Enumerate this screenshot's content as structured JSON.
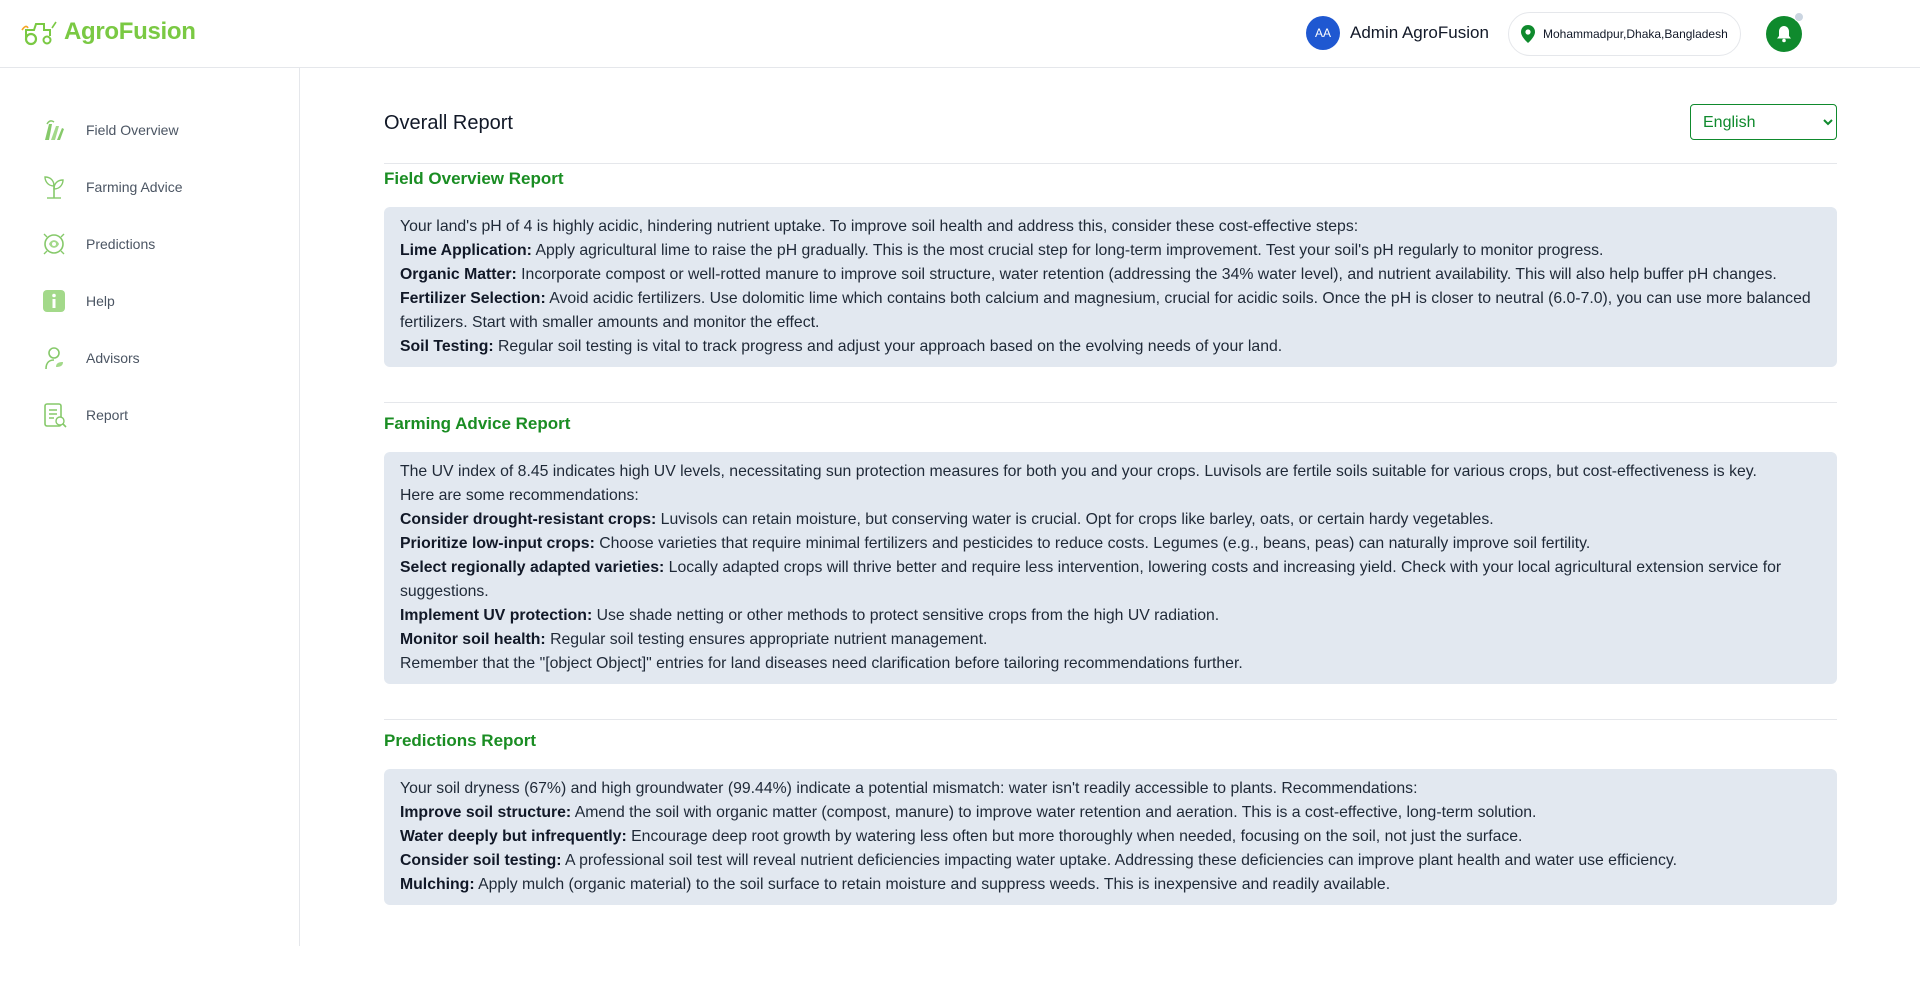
{
  "brand": {
    "name": "AgroFusion"
  },
  "header": {
    "avatar_initials": "AA",
    "user_name": "Admin AgroFusion",
    "location": "Mohammadpur,Dhaka,Bangladesh"
  },
  "colors": {
    "brand_green": "#7ac943",
    "accent_green": "#0f8a2d",
    "avatar_blue": "#1f58d1",
    "report_box": "#e2e8f0"
  },
  "sidebar": {
    "items": [
      {
        "label": "Field Overview",
        "icon": "field-icon"
      },
      {
        "label": "Farming Advice",
        "icon": "plant-icon"
      },
      {
        "label": "Predictions",
        "icon": "prediction-icon"
      },
      {
        "label": "Help",
        "icon": "info-icon"
      },
      {
        "label": "Advisors",
        "icon": "advisor-icon"
      },
      {
        "label": "Report",
        "icon": "report-icon"
      }
    ]
  },
  "main": {
    "title": "Overall Report",
    "language": {
      "selected": "English"
    },
    "sections": [
      {
        "title": "Field Overview Report",
        "lines": [
          {
            "bold": "",
            "text": "Your land's pH of 4 is highly acidic, hindering nutrient uptake. To improve soil health and address this, consider these cost-effective steps:"
          },
          {
            "bold": "Lime Application:",
            "text": " Apply agricultural lime to raise the pH gradually. This is the most crucial step for long-term improvement. Test your soil's pH regularly to monitor progress."
          },
          {
            "bold": "Organic Matter:",
            "text": " Incorporate compost or well-rotted manure to improve soil structure, water retention (addressing the 34% water level), and nutrient availability. This will also help buffer pH changes."
          },
          {
            "bold": "Fertilizer Selection:",
            "text": " Avoid acidic fertilizers. Use dolomitic lime which contains both calcium and magnesium, crucial for acidic soils. Once the pH is closer to neutral (6.0-7.0), you can use more balanced fertilizers. Start with smaller amounts and monitor the effect."
          },
          {
            "bold": "Soil Testing:",
            "text": " Regular soil testing is vital to track progress and adjust your approach based on the evolving needs of your land."
          }
        ]
      },
      {
        "title": "Farming Advice Report",
        "lines": [
          {
            "bold": "",
            "text": "The UV index of 8.45 indicates high UV levels, necessitating sun protection measures for both you and your crops. Luvisols are fertile soils suitable for various crops, but cost-effectiveness is key."
          },
          {
            "bold": "",
            "text": "Here are some recommendations:"
          },
          {
            "bold": "Consider drought-resistant crops:",
            "text": " Luvisols can retain moisture, but conserving water is crucial. Opt for crops like barley, oats, or certain hardy vegetables."
          },
          {
            "bold": "Prioritize low-input crops:",
            "text": " Choose varieties that require minimal fertilizers and pesticides to reduce costs. Legumes (e.g., beans, peas) can naturally improve soil fertility."
          },
          {
            "bold": "Select regionally adapted varieties:",
            "text": " Locally adapted crops will thrive better and require less intervention, lowering costs and increasing yield. Check with your local agricultural extension service for suggestions."
          },
          {
            "bold": "Implement UV protection:",
            "text": " Use shade netting or other methods to protect sensitive crops from the high UV radiation."
          },
          {
            "bold": "Monitor soil health:",
            "text": " Regular soil testing ensures appropriate nutrient management."
          },
          {
            "bold": "",
            "text": "Remember that the \"[object Object]\" entries for land diseases need clarification before tailoring recommendations further."
          }
        ]
      },
      {
        "title": "Predictions Report",
        "lines": [
          {
            "bold": "",
            "text": "Your soil dryness (67%) and high groundwater (99.44%) indicate a potential mismatch: water isn't readily accessible to plants. Recommendations:"
          },
          {
            "bold": "Improve soil structure:",
            "text": " Amend the soil with organic matter (compost, manure) to improve water retention and aeration. This is a cost-effective, long-term solution."
          },
          {
            "bold": "Water deeply but infrequently:",
            "text": " Encourage deep root growth by watering less often but more thoroughly when needed, focusing on the soil, not just the surface."
          },
          {
            "bold": "Consider soil testing:",
            "text": " A professional soil test will reveal nutrient deficiencies impacting water uptake. Addressing these deficiencies can improve plant health and water use efficiency."
          },
          {
            "bold": "Mulching:",
            "text": " Apply mulch (organic material) to the soil surface to retain moisture and suppress weeds. This is inexpensive and readily available."
          }
        ]
      }
    ]
  }
}
